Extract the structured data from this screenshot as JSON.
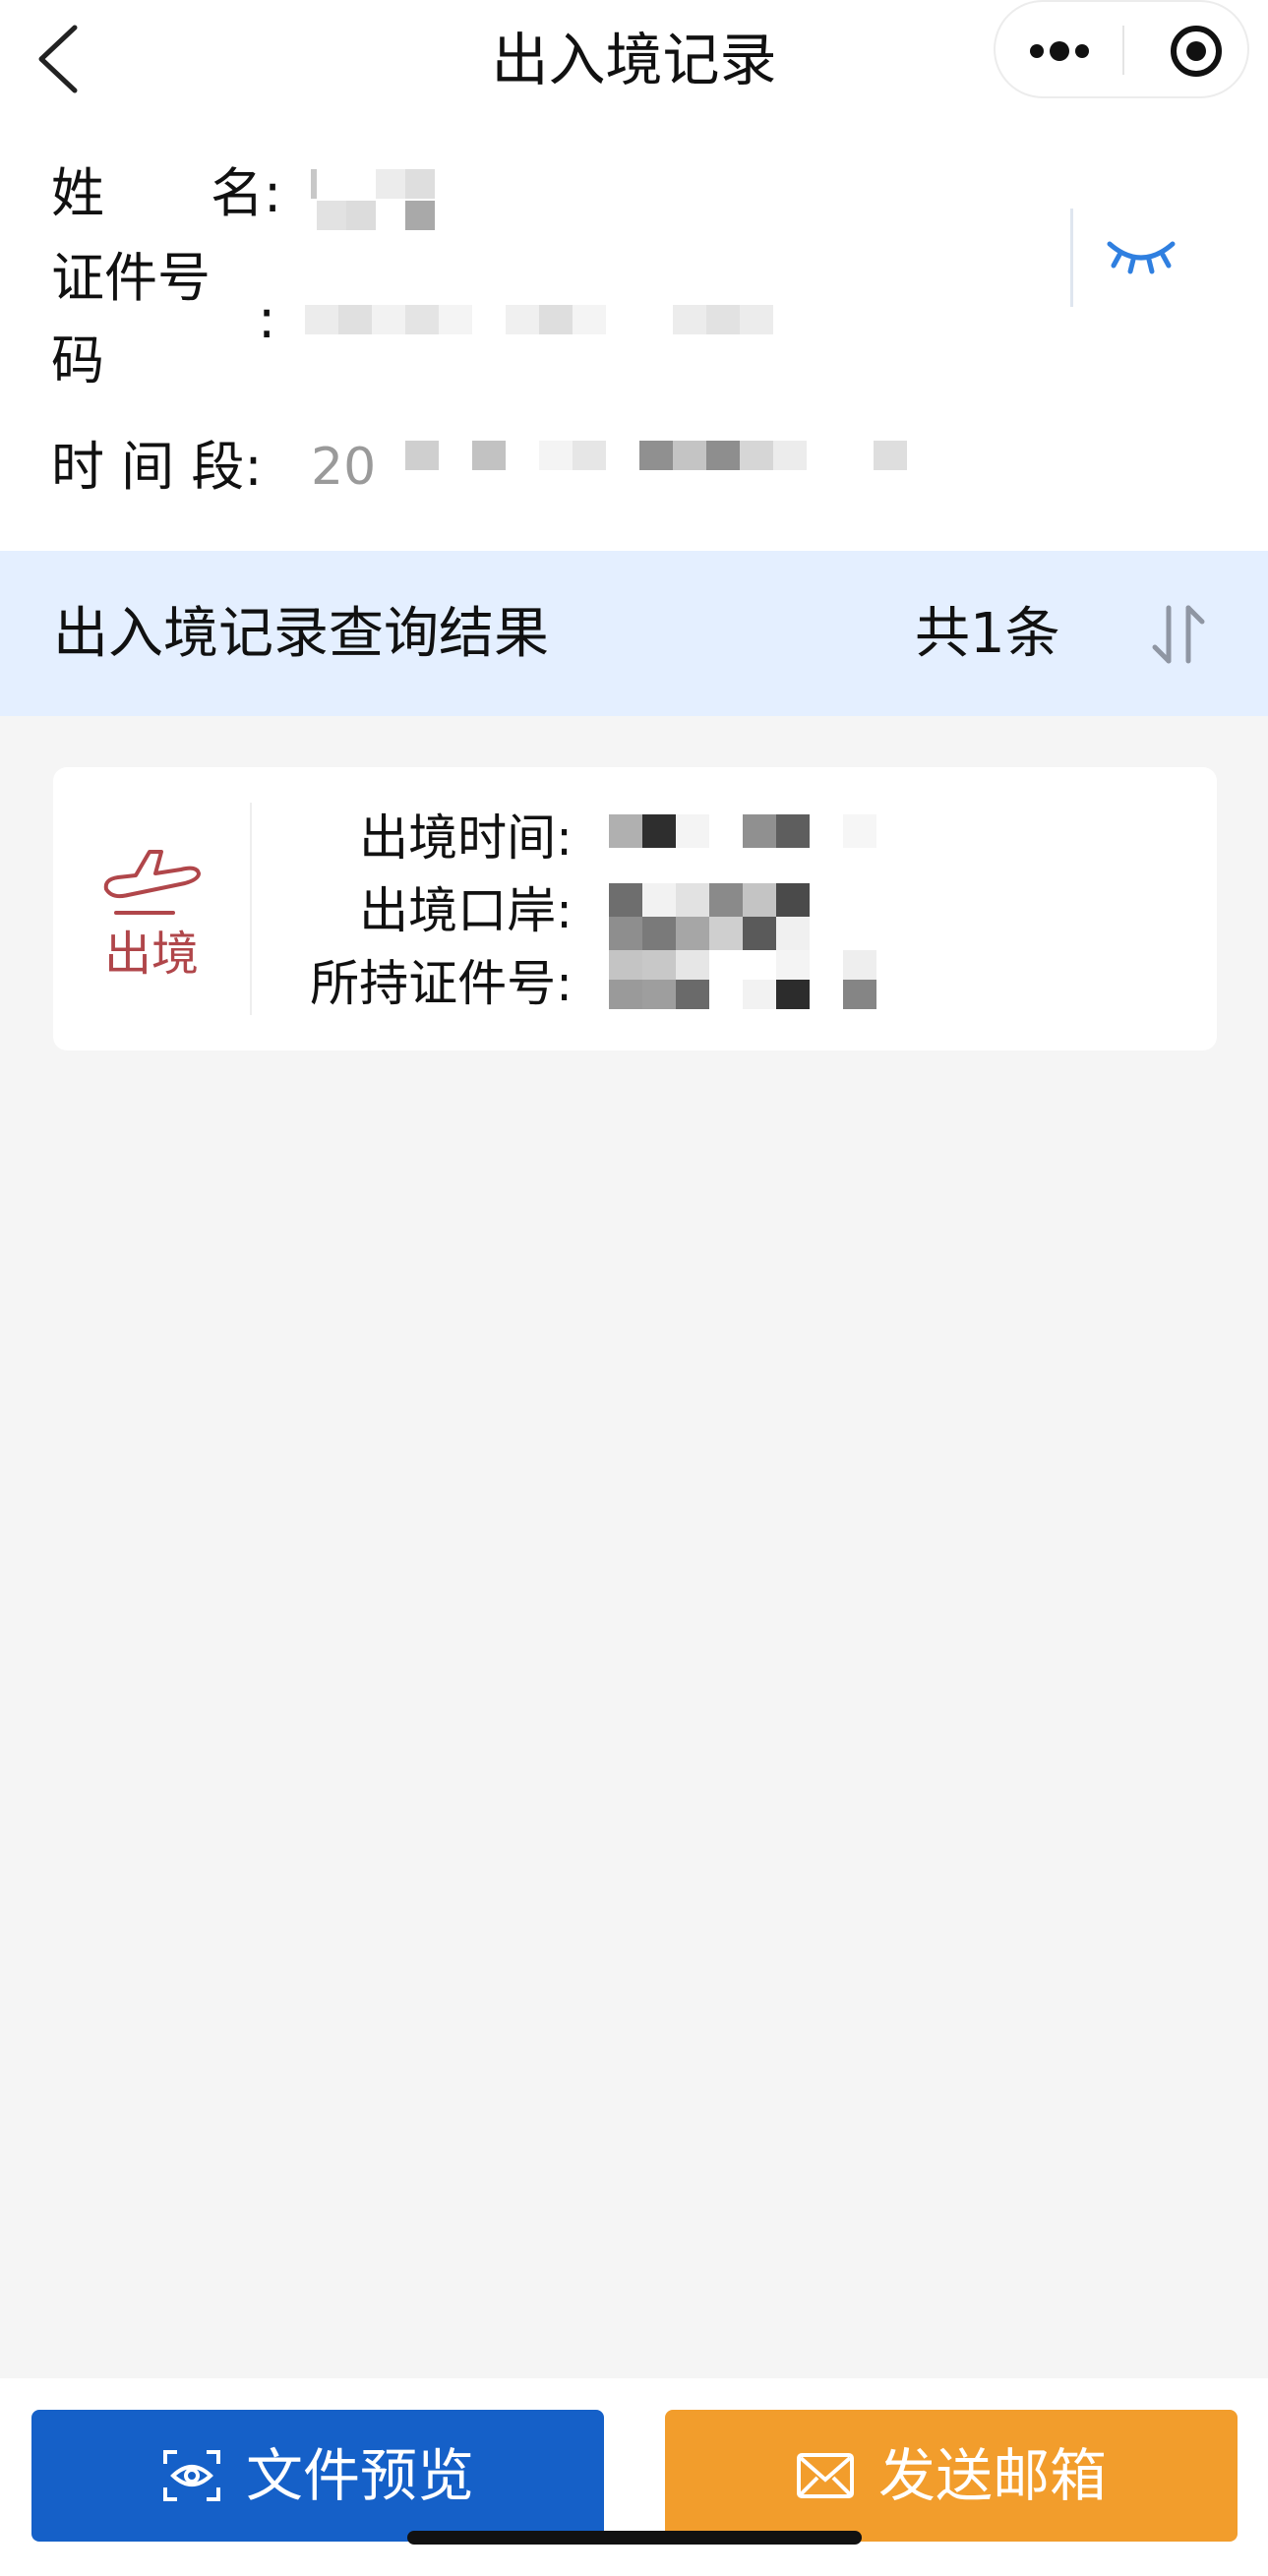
{
  "nav": {
    "title": "出入境记录",
    "back_icon": "chevron-left-icon",
    "more_icon": "more-dots-icon",
    "close_icon": "target-icon"
  },
  "info": {
    "name_label": "姓　　名:",
    "id_label_line1": "证件号",
    "id_label_line2": "码",
    "id_label_colon": ":",
    "time_label": "时 间 段:",
    "time_value_prefix": "20",
    "toggle_icon": "eye-closed-icon"
  },
  "results": {
    "title": "出入境记录查询结果",
    "count": "共1条",
    "sort_icon": "sort-arrows-icon"
  },
  "records": [
    {
      "direction": "出境",
      "direction_icon": "airplane-departure-icon",
      "time_label": "出境时间:",
      "port_label": "出境口岸:",
      "cert_label": "所持证件号:"
    }
  ],
  "buttons": {
    "preview_label": "文件预览",
    "preview_icon": "preview-scan-icon",
    "mail_label": "发送邮箱",
    "mail_icon": "mail-icon"
  },
  "colors": {
    "primary_blue": "#1560c8",
    "orange": "#f29d2c",
    "departure_red": "#b0464a",
    "result_header_bg": "#e4efff",
    "eye_blue": "#2f7fe0"
  }
}
